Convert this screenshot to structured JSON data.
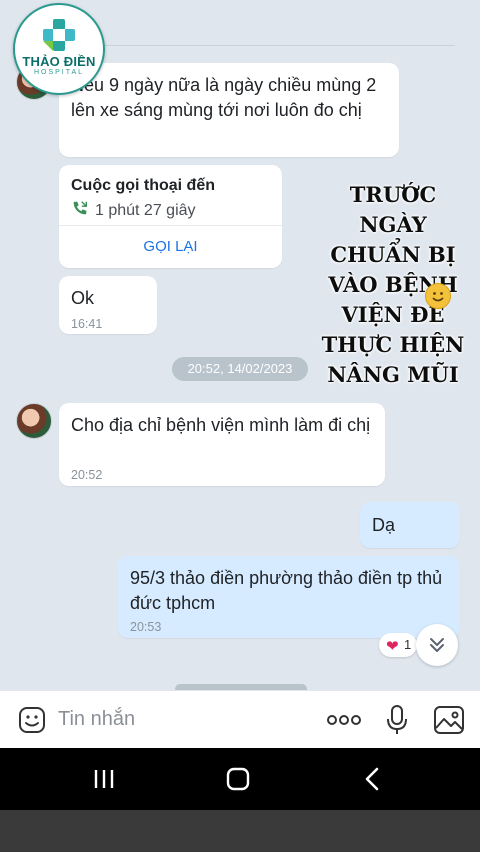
{
  "brand": {
    "name": "THẢO ĐIỀN",
    "subtitle": "HOSPITAL",
    "colors": {
      "primary": "#0c6e6b",
      "accent": "#2a9a8f"
    }
  },
  "messages": [
    {
      "id": "m1",
      "text": "Nếu 9 ngày nữa là ngày chiều mùng 2 lên xe sáng mùng tới nơi luôn đo chị"
    },
    {
      "id": "m3",
      "text": "Ok",
      "time": "16:41"
    },
    {
      "id": "m4",
      "text": "Cho địa chỉ bệnh viện mình làm đi chị",
      "time": "20:52"
    },
    {
      "id": "m5",
      "text": "Dạ"
    },
    {
      "id": "m6",
      "text": "95/3 thảo điền phường thảo điền tp thủ đức tphcm",
      "time": "20:53"
    }
  ],
  "call": {
    "title": "Cuộc gọi thoại đến",
    "duration": "1 phút 27 giây",
    "callback_label": "GỌI LẠI",
    "icon": "phone-incoming-icon"
  },
  "date_separator": "20:52, 14/02/2023",
  "overlay_text": {
    "lines": [
      "TRƯỚC",
      "NGÀY",
      "CHUẨN BỊ",
      "VÀO BỆNH",
      "VIỆN ĐỂ",
      "THỰC HIỆN",
      "NÂNG MŨI"
    ],
    "emoji": "smiling-face-emoji"
  },
  "reaction": {
    "emoji": "heart-icon",
    "count": "1",
    "symbol": "❤"
  },
  "composer": {
    "placeholder": "Tin nhắn",
    "more_symbol": "ooo"
  },
  "icons": {
    "sticker": "sticker-icon",
    "more": "more-options-icon",
    "mic": "microphone-icon",
    "image": "image-icon",
    "scroll_down": "double-chevron-down-icon",
    "nav_recents": "recents-icon",
    "nav_home": "home-icon",
    "nav_back": "back-icon"
  },
  "colors": {
    "chat_background": "#dfe6ee",
    "incoming_bubble": "#ffffff",
    "outgoing_bubble": "#d6ebff",
    "link_blue": "#1a73e8"
  }
}
